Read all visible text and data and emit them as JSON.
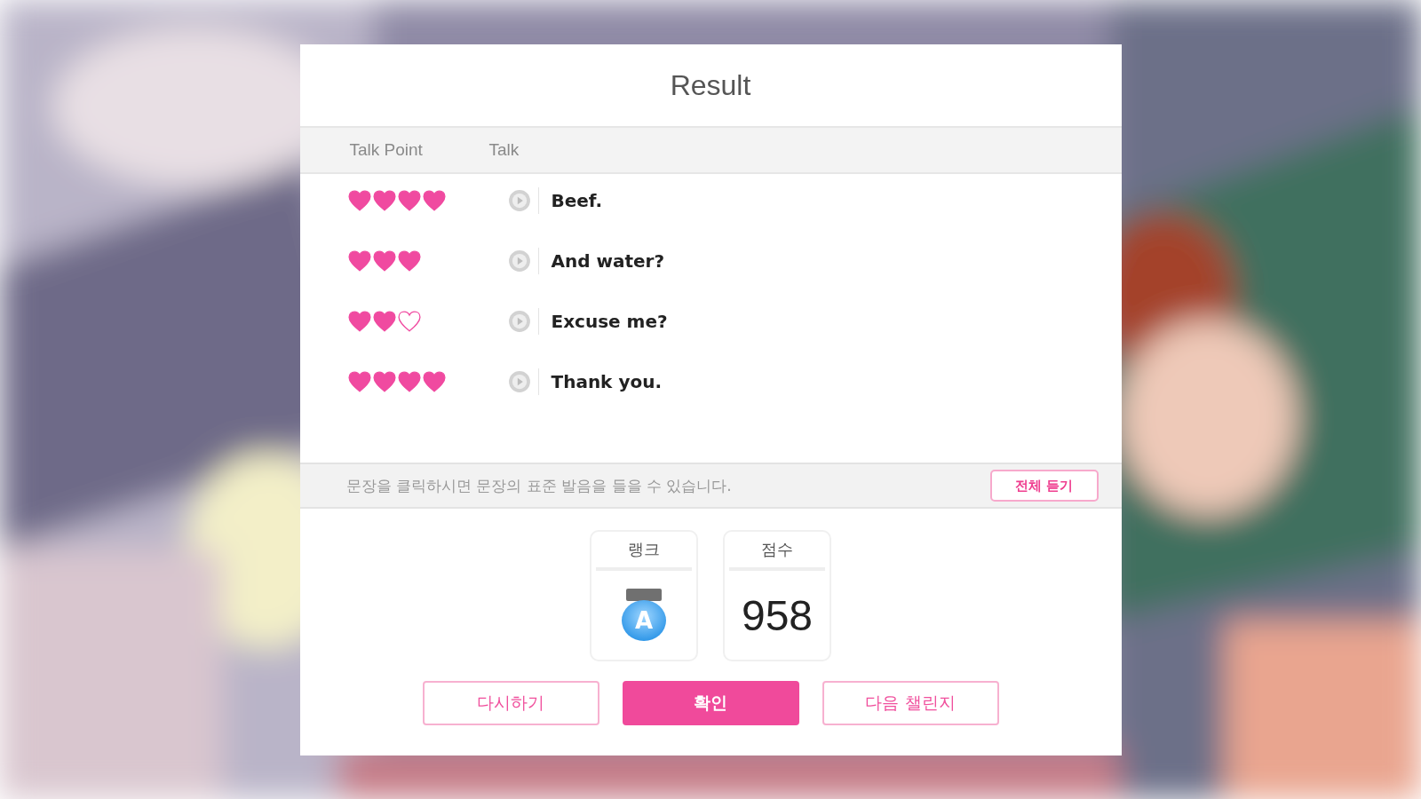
{
  "dialog": {
    "title": "Result"
  },
  "table": {
    "columns": [
      "Talk Point",
      "Talk"
    ],
    "rows": [
      {
        "hearts": [
          {
            "filled": true
          },
          {
            "filled": true
          },
          {
            "filled": true
          },
          {
            "filled": true
          }
        ],
        "talk": "Beef."
      },
      {
        "hearts": [
          {
            "filled": true
          },
          {
            "filled": true
          },
          {
            "filled": true
          }
        ],
        "talk": "And water?"
      },
      {
        "hearts": [
          {
            "filled": true
          },
          {
            "filled": true
          },
          {
            "filled": false
          }
        ],
        "talk": "Excuse me?"
      },
      {
        "hearts": [
          {
            "filled": true
          },
          {
            "filled": true
          },
          {
            "filled": true
          },
          {
            "filled": true
          }
        ],
        "talk": "Thank you."
      }
    ]
  },
  "hint_bar": {
    "text": "문장을 클릭하시면 문장의 표준 발음을 들을 수 있습니다.",
    "button": "전체 듣기"
  },
  "rank": {
    "label": "랭크",
    "grade": "A"
  },
  "score": {
    "label": "점수",
    "value": "958"
  },
  "buttons": [
    {
      "label": "다시하기",
      "kind": "outline"
    },
    {
      "label": "확인",
      "kind": "primary"
    },
    {
      "label": "다음 챌린지",
      "kind": "outline"
    }
  ]
}
